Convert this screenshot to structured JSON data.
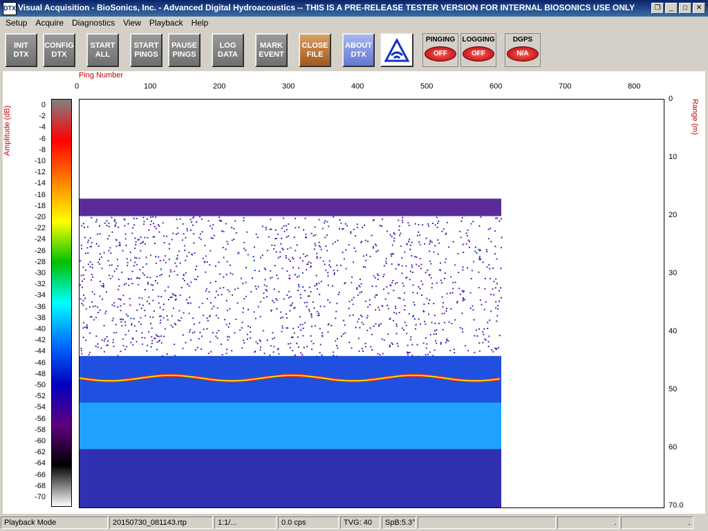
{
  "window": {
    "icon_text": "DTX",
    "title": "Visual Acquisition  -  BioSonics, Inc.  -  Advanced Digital Hydroacoustics  -- THIS IS A PRE-RELEASE TESTER VERSION FOR INTERNAL BIOSONICS USE ONLY",
    "restore_glyph": "❐",
    "minimize_glyph": "_",
    "maximize_glyph": "□",
    "close_glyph": "✕"
  },
  "menu": [
    "Setup",
    "Acquire",
    "Diagnostics",
    "View",
    "Playback",
    "Help"
  ],
  "toolbar": {
    "buttons": [
      {
        "line1": "INIT",
        "line2": "DTX"
      },
      {
        "line1": "CONFIG",
        "line2": "DTX"
      },
      {
        "line1": "START",
        "line2": "ALL"
      },
      {
        "line1": "START",
        "line2": "PINGS"
      },
      {
        "line1": "PAUSE",
        "line2": "PINGS"
      },
      {
        "line1": "LOG",
        "line2": "DATA"
      },
      {
        "line1": "MARK",
        "line2": "EVENT"
      },
      {
        "line1": "CLOSE",
        "line2": "FILE"
      },
      {
        "line1": "ABOUT",
        "line2": "DTX"
      }
    ],
    "indicators": [
      {
        "label": "PINGING",
        "value": "OFF"
      },
      {
        "label": "LOGGING",
        "value": "OFF"
      },
      {
        "label": "DGPS",
        "value": "N/A"
      }
    ]
  },
  "plot": {
    "x_axis_label": "Ping Number",
    "x_ticks": [
      "0",
      "100",
      "200",
      "300",
      "400",
      "500",
      "600",
      "700",
      "800"
    ],
    "left_axis_label": "Amplitude (dB)",
    "left_ticks": [
      "0",
      "-2",
      "-4",
      "-6",
      "-8",
      "-10",
      "-12",
      "-14",
      "-16",
      "-18",
      "-20",
      "-22",
      "-24",
      "-26",
      "-28",
      "-30",
      "-32",
      "-34",
      "-36",
      "-38",
      "-40",
      "-42",
      "-44",
      "-46",
      "-48",
      "-50",
      "-52",
      "-54",
      "-56",
      "-58",
      "-60",
      "-62",
      "-64",
      "-66",
      "-68",
      "-70"
    ],
    "right_axis_label": "Range (m)",
    "right_ticks": [
      "0",
      "10",
      "20",
      "30",
      "40",
      "50",
      "60",
      "70.0"
    ],
    "data_extent_pings": 610,
    "x_max": 845,
    "range_max": 70,
    "surface_band_m": [
      17,
      20
    ],
    "bottom_echo_m": 47.8,
    "colors": {
      "axis_label": "#c00000",
      "colormap": [
        "#808080",
        "#ff0000",
        "#ff8000",
        "#ffff00",
        "#00c000",
        "#00ffff",
        "#0070ff",
        "#0000c0",
        "#600080",
        "#000000",
        "#ffffff"
      ]
    }
  },
  "status": [
    "Playback Mode",
    "20150730_081143.rtp",
    "1:1/...",
    "0.0 cps",
    "TVG: 40",
    "SpB:5.3°",
    "",
    ".",
    "."
  ]
}
